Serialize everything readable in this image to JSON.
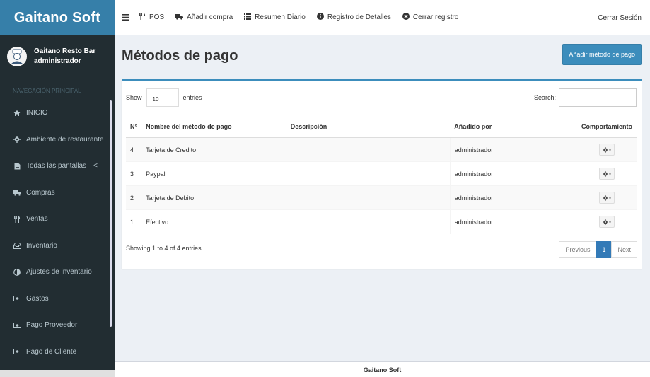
{
  "brand": {
    "title": "Gaitano Soft"
  },
  "user": {
    "name": "Gaitano Resto Bar",
    "role": "administrador"
  },
  "sidebar": {
    "header": "NAVEGACIÓN PRINCIPAL",
    "items": [
      {
        "label": "INICIO",
        "icon": "home-icon"
      },
      {
        "label": "Ambiente de restaurante",
        "icon": "gear-icon"
      },
      {
        "label": "Todas las pantallas",
        "icon": "file-icon",
        "caret": "<"
      },
      {
        "label": "Compras",
        "icon": "truck-icon"
      },
      {
        "label": "Ventas",
        "icon": "cutlery-icon"
      },
      {
        "label": "Inventario",
        "icon": "archive-icon"
      },
      {
        "label": "Ajustes de inventario",
        "icon": "adjust-icon"
      },
      {
        "label": "Gastos",
        "icon": "money-icon"
      },
      {
        "label": "Pago Proveedor",
        "icon": "money-icon"
      },
      {
        "label": "Pago de Cliente",
        "icon": "money-icon"
      }
    ]
  },
  "topbar": {
    "menu_icon": "hamburger-icon",
    "items": [
      {
        "label": "POS",
        "icon": "cutlery-icon"
      },
      {
        "label": "Añadir compra",
        "icon": "truck-icon"
      },
      {
        "label": "Resumen Diario",
        "icon": "list-icon"
      },
      {
        "label": "Registro de Detalles",
        "icon": "info-icon"
      },
      {
        "label": "Cerrar registro",
        "icon": "close-circle-icon"
      }
    ],
    "logout": "Cerrar Sesión"
  },
  "page": {
    "title": "Métodos de pago",
    "add_button": "Añadir método de pago"
  },
  "table": {
    "show_label": "Show",
    "entries_label": "entries",
    "page_length": "10",
    "search_label": "Search:",
    "search_value": "",
    "columns": [
      "N°",
      "Nombre del método de pago",
      "Descripción",
      "Añadido por",
      "Comportamiento"
    ],
    "rows": [
      {
        "no": "4",
        "name": "Tarjeta de Credito",
        "desc": "",
        "by": "administrador"
      },
      {
        "no": "3",
        "name": "Paypal",
        "desc": "",
        "by": "administrador"
      },
      {
        "no": "2",
        "name": "Tarjeta de Debito",
        "desc": "",
        "by": "administrador"
      },
      {
        "no": "1",
        "name": "Efectivo",
        "desc": "",
        "by": "administrador"
      }
    ],
    "info": "Showing 1 to 4 of 4 entries",
    "pagination": {
      "previous": "Previous",
      "current": "1",
      "next": "Next"
    }
  },
  "footer": {
    "text": "Gaitano Soft"
  },
  "colors": {
    "brand": "#367fa9",
    "sidebar": "#222d32",
    "primary": "#3c8dbc",
    "background": "#ecf0f5"
  }
}
